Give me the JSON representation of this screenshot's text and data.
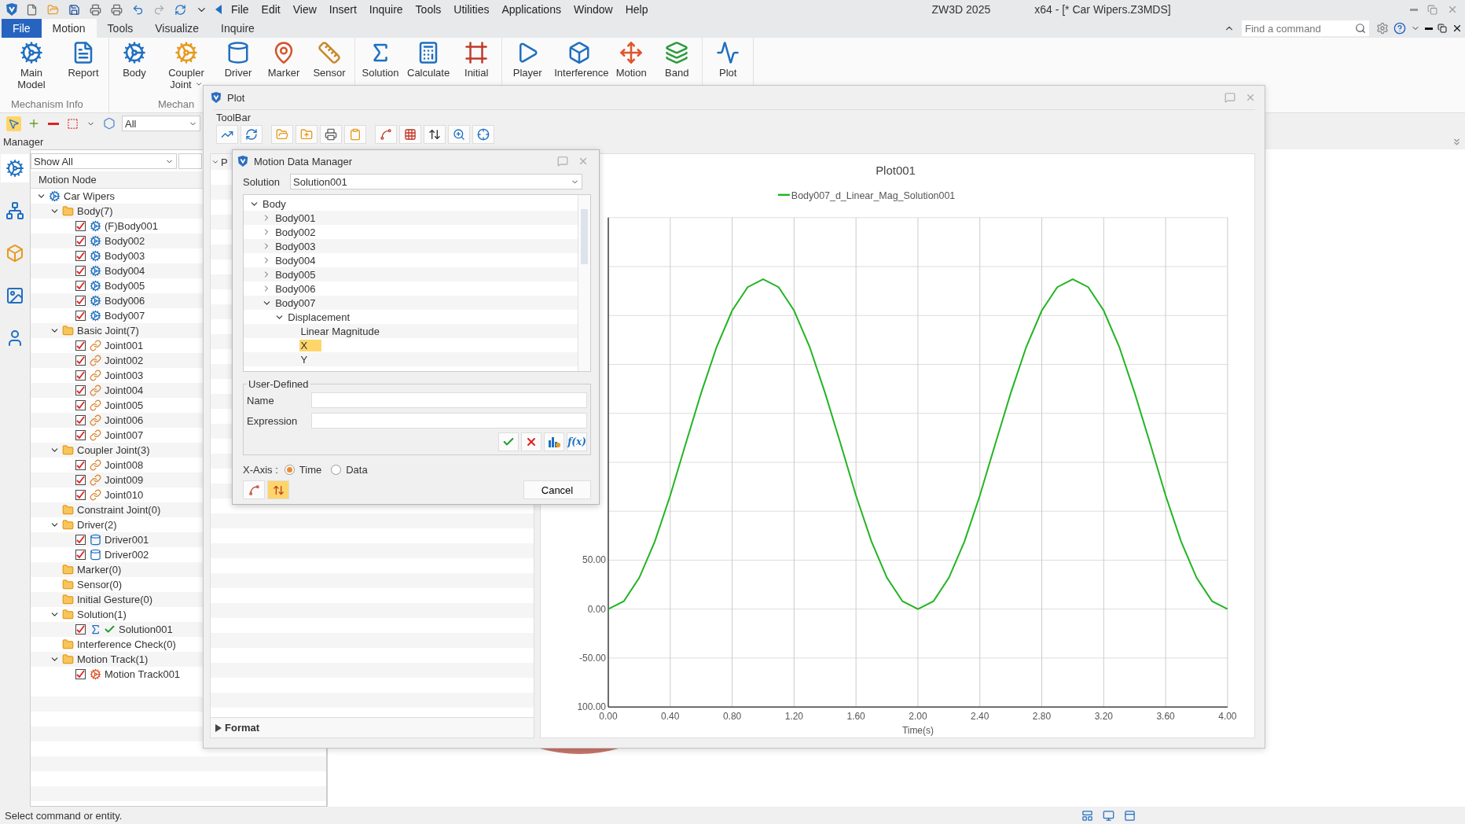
{
  "title_bar": {
    "menu": [
      "File",
      "Edit",
      "View",
      "Insert",
      "Inquire",
      "Tools",
      "Utilities",
      "Applications",
      "Window",
      "Help"
    ],
    "app_title": "ZW3D 2025",
    "document_title": "x64 - [* Car Wipers.Z3MDS]"
  },
  "ribbon_tabs": [
    {
      "label": "File",
      "kind": "file",
      "selected": false
    },
    {
      "label": "Motion",
      "kind": "tab",
      "selected": true
    },
    {
      "label": "Tools",
      "kind": "tab",
      "selected": false
    },
    {
      "label": "Visualize",
      "kind": "tab",
      "selected": false
    },
    {
      "label": "Inquire",
      "kind": "tab",
      "selected": false
    }
  ],
  "command_search": {
    "placeholder": "Find a command"
  },
  "ribbon_groups": [
    {
      "label": "Mechanism Info",
      "buttons": [
        {
          "label": "Main Model"
        },
        {
          "label": "Report"
        }
      ]
    },
    {
      "label": "Mechan",
      "buttons": [
        {
          "label": "Body"
        },
        {
          "label": "Coupler Joint",
          "has_menu": true
        },
        {
          "label": "Driver"
        },
        {
          "label": "Marker"
        },
        {
          "label": "Sensor"
        }
      ]
    },
    {
      "buttons": [
        {
          "label": "Solution"
        },
        {
          "label": "Calculate"
        },
        {
          "label": "Initial"
        }
      ]
    },
    {
      "buttons": [
        {
          "label": "Player"
        },
        {
          "label": "Interference"
        },
        {
          "label": "Motion"
        },
        {
          "label": "Band"
        }
      ]
    },
    {
      "buttons": [
        {
          "label": "Plot"
        }
      ]
    }
  ],
  "selection_bar": {
    "filter": "All"
  },
  "manager": {
    "title": "Manager",
    "filter": "Show All",
    "column": "Motion Node",
    "tree": [
      {
        "label": "Car Wipers",
        "kind": "root",
        "expanded": true,
        "children": [
          {
            "label": "Body(7)",
            "kind": "folder",
            "expanded": true,
            "children": [
              {
                "label": "(F)Body001",
                "kind": "body",
                "checked": true
              },
              {
                "label": "Body002",
                "kind": "body",
                "checked": true
              },
              {
                "label": "Body003",
                "kind": "body",
                "checked": true
              },
              {
                "label": "Body004",
                "kind": "body",
                "checked": true
              },
              {
                "label": "Body005",
                "kind": "body",
                "checked": true
              },
              {
                "label": "Body006",
                "kind": "body",
                "checked": true
              },
              {
                "label": "Body007",
                "kind": "body",
                "checked": true
              }
            ]
          },
          {
            "label": "Basic Joint(7)",
            "kind": "folder",
            "expanded": true,
            "children": [
              {
                "label": "Joint001",
                "kind": "joint",
                "checked": true
              },
              {
                "label": "Joint002",
                "kind": "joint",
                "checked": true
              },
              {
                "label": "Joint003",
                "kind": "joint",
                "checked": true
              },
              {
                "label": "Joint004",
                "kind": "joint",
                "checked": true
              },
              {
                "label": "Joint005",
                "kind": "joint",
                "checked": true
              },
              {
                "label": "Joint006",
                "kind": "joint",
                "checked": true
              },
              {
                "label": "Joint007",
                "kind": "joint",
                "checked": true
              }
            ]
          },
          {
            "label": "Coupler Joint(3)",
            "kind": "folder",
            "expanded": true,
            "children": [
              {
                "label": "Joint008",
                "kind": "joint",
                "checked": true
              },
              {
                "label": "Joint009",
                "kind": "joint",
                "checked": true
              },
              {
                "label": "Joint010",
                "kind": "joint",
                "checked": true
              }
            ]
          },
          {
            "label": "Constraint Joint(0)",
            "kind": "folder"
          },
          {
            "label": "Driver(2)",
            "kind": "folder",
            "expanded": true,
            "children": [
              {
                "label": "Driver001",
                "kind": "driver",
                "checked": true
              },
              {
                "label": "Driver002",
                "kind": "driver",
                "checked": true
              }
            ]
          },
          {
            "label": "Marker(0)",
            "kind": "folder"
          },
          {
            "label": "Sensor(0)",
            "kind": "folder"
          },
          {
            "label": "Initial Gesture(0)",
            "kind": "folder"
          },
          {
            "label": "Solution(1)",
            "kind": "folder",
            "expanded": true,
            "children": [
              {
                "label": "Solution001",
                "kind": "solution",
                "checked": true,
                "solved": true
              }
            ]
          },
          {
            "label": "Interference Check(0)",
            "kind": "folder"
          },
          {
            "label": "Motion Track(1)",
            "kind": "folder",
            "expanded": true,
            "children": [
              {
                "label": "Motion Track001",
                "kind": "track",
                "checked": true
              }
            ]
          }
        ]
      }
    ]
  },
  "plot_window": {
    "title": "Plot",
    "toolbar_label": "ToolBar",
    "section_header": "P",
    "format_label": "Format",
    "chart_data": {
      "type": "line",
      "grid": true,
      "title": "Plot001",
      "xlabel": "Time(s)",
      "xlim": [
        0,
        4
      ],
      "ylim": [
        -100,
        400
      ],
      "xticks": [
        {
          "value": 0,
          "label": "0.00"
        },
        {
          "value": 0.4,
          "label": "0.40"
        },
        {
          "value": 0.8,
          "label": "0.80"
        },
        {
          "value": 1.2,
          "label": "1.20"
        },
        {
          "value": 1.6,
          "label": "1.60"
        },
        {
          "value": 2,
          "label": "2.00"
        },
        {
          "value": 2.4,
          "label": "2.40"
        },
        {
          "value": 2.8,
          "label": "2.80"
        },
        {
          "value": 3.2,
          "label": "3.20"
        },
        {
          "value": 3.6,
          "label": "3.60"
        },
        {
          "value": 4,
          "label": "4.00"
        }
      ],
      "yticks": [
        {
          "value": -100,
          "label": "100.00"
        },
        {
          "value": -50,
          "label": "-50.00"
        },
        {
          "value": 0,
          "label": "0.00"
        },
        {
          "value": 50,
          "label": "50.00"
        }
      ],
      "x": [
        0,
        0.1,
        0.2,
        0.3,
        0.4,
        0.5,
        0.6,
        0.7,
        0.8,
        0.9,
        1,
        1.1,
        1.2,
        1.3,
        1.4,
        1.5,
        1.6,
        1.7,
        1.8,
        1.9,
        2,
        2.1,
        2.2,
        2.3,
        2.4,
        2.5,
        2.6,
        2.7,
        2.8,
        2.9,
        3,
        3.1,
        3.2,
        3.3,
        3.4,
        3.5,
        3.6,
        3.7,
        3.8,
        3.9,
        4
      ],
      "series": [
        {
          "name": "Body007_d_Linear_Mag_Solution001",
          "color": "#22b422",
          "values": [
            0,
            8,
            32,
            69,
            116,
            169,
            221,
            268,
            305,
            329,
            337,
            329,
            305,
            268,
            221,
            169,
            116,
            69,
            32,
            8,
            0,
            8,
            32,
            69,
            116,
            169,
            221,
            268,
            305,
            329,
            337,
            329,
            305,
            268,
            221,
            169,
            116,
            69,
            32,
            8,
            0
          ]
        }
      ]
    }
  },
  "data_manager": {
    "title": "Motion Data Manager",
    "solution_label": "Solution",
    "solution": "Solution001",
    "tree": [
      {
        "label": "Body",
        "expanded": true,
        "children": [
          {
            "label": "Body001",
            "expanded": false
          },
          {
            "label": "Body002",
            "expanded": false
          },
          {
            "label": "Body003",
            "expanded": false
          },
          {
            "label": "Body004",
            "expanded": false
          },
          {
            "label": "Body005",
            "expanded": false
          },
          {
            "label": "Body006",
            "expanded": false
          },
          {
            "label": "Body007",
            "expanded": true,
            "children": [
              {
                "label": "Displacement",
                "expanded": true,
                "children": [
                  {
                    "label": "Linear Magnitude",
                    "selected": false
                  },
                  {
                    "label": "X",
                    "selected": true
                  },
                  {
                    "label": "Y",
                    "selected": false
                  }
                ]
              }
            ]
          }
        ]
      }
    ],
    "user_defined": {
      "title": "User-Defined",
      "fields": [
        {
          "label": "Name"
        },
        {
          "label": "Expression"
        }
      ],
      "function_button": "f(x)"
    },
    "x_axis": {
      "label": "X-Axis :",
      "options": [
        {
          "label": "Time",
          "selected": true
        },
        {
          "label": "Data",
          "selected": false
        }
      ]
    },
    "tool_buttons": [
      {
        "kind": "curve",
        "highlighted": false
      },
      {
        "kind": "axis",
        "highlighted": true
      }
    ],
    "cancel": "Cancel"
  },
  "status_bar": {
    "message": "Select command or entity."
  }
}
